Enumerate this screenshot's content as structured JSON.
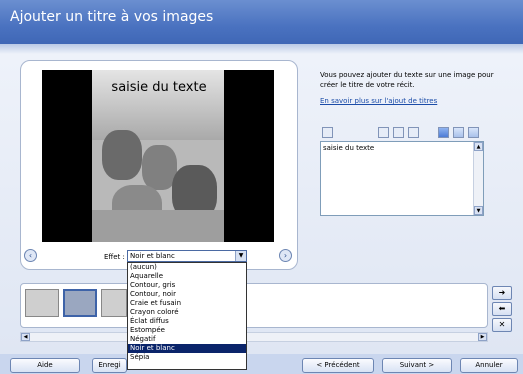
{
  "header": {
    "title": "Ajouter un titre à vos images"
  },
  "preview": {
    "overlay_text": "saisie du texte",
    "prev_label": "‹",
    "next_label": "›",
    "effect_label": "Effet :",
    "effect_value": "Noir et blanc",
    "effect_options": [
      "(aucun)",
      "Aquarelle",
      "Contour, gris",
      "Contour, noir",
      "Craie et fusain",
      "Crayon coloré",
      "Éclat diffus",
      "Estompée",
      "Négatif",
      "Noir et blanc",
      "Sépia"
    ],
    "selected_option": "Noir et blanc"
  },
  "info": {
    "description": "Vous pouvez ajouter du texte sur une image pour créer le titre de votre récit.",
    "link": "En savoir plus sur l'ajout de titres"
  },
  "editor": {
    "text_value": "saisie du texte"
  },
  "side_buttons": {
    "right": "➜",
    "left": "⬅",
    "remove": "✕"
  },
  "buttons": {
    "help": "Aide",
    "save": "Enregi",
    "previous": "< Précédent",
    "next": "Suivant >",
    "cancel": "Annuler"
  },
  "colors": {
    "header": "#4a72c0",
    "selection": "#0a246a",
    "link": "#1b4ca8"
  },
  "icons": [
    "prev-icon",
    "next-icon",
    "font-icon",
    "align-left-icon",
    "align-center-icon",
    "align-right-icon",
    "position-top-icon",
    "position-middle-icon",
    "position-bottom-icon",
    "move-right-icon",
    "move-left-icon",
    "remove-icon",
    "edit-icon"
  ]
}
